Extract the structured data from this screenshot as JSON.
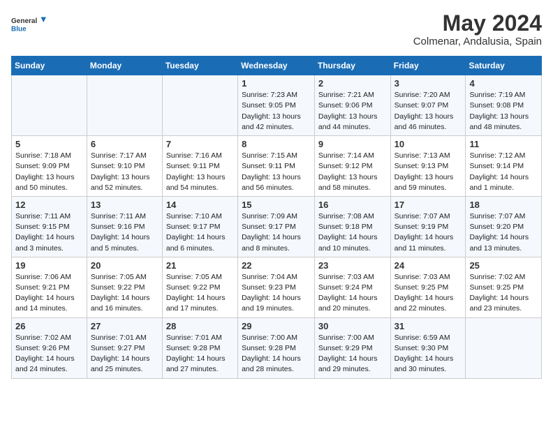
{
  "logo": {
    "text_general": "General",
    "text_blue": "Blue"
  },
  "header": {
    "month": "May 2024",
    "location": "Colmenar, Andalusia, Spain"
  },
  "weekdays": [
    "Sunday",
    "Monday",
    "Tuesday",
    "Wednesday",
    "Thursday",
    "Friday",
    "Saturday"
  ],
  "weeks": [
    [
      {
        "day": "",
        "info": ""
      },
      {
        "day": "",
        "info": ""
      },
      {
        "day": "",
        "info": ""
      },
      {
        "day": "1",
        "info": "Sunrise: 7:23 AM\nSunset: 9:05 PM\nDaylight: 13 hours\nand 42 minutes."
      },
      {
        "day": "2",
        "info": "Sunrise: 7:21 AM\nSunset: 9:06 PM\nDaylight: 13 hours\nand 44 minutes."
      },
      {
        "day": "3",
        "info": "Sunrise: 7:20 AM\nSunset: 9:07 PM\nDaylight: 13 hours\nand 46 minutes."
      },
      {
        "day": "4",
        "info": "Sunrise: 7:19 AM\nSunset: 9:08 PM\nDaylight: 13 hours\nand 48 minutes."
      }
    ],
    [
      {
        "day": "5",
        "info": "Sunrise: 7:18 AM\nSunset: 9:09 PM\nDaylight: 13 hours\nand 50 minutes."
      },
      {
        "day": "6",
        "info": "Sunrise: 7:17 AM\nSunset: 9:10 PM\nDaylight: 13 hours\nand 52 minutes."
      },
      {
        "day": "7",
        "info": "Sunrise: 7:16 AM\nSunset: 9:11 PM\nDaylight: 13 hours\nand 54 minutes."
      },
      {
        "day": "8",
        "info": "Sunrise: 7:15 AM\nSunset: 9:11 PM\nDaylight: 13 hours\nand 56 minutes."
      },
      {
        "day": "9",
        "info": "Sunrise: 7:14 AM\nSunset: 9:12 PM\nDaylight: 13 hours\nand 58 minutes."
      },
      {
        "day": "10",
        "info": "Sunrise: 7:13 AM\nSunset: 9:13 PM\nDaylight: 13 hours\nand 59 minutes."
      },
      {
        "day": "11",
        "info": "Sunrise: 7:12 AM\nSunset: 9:14 PM\nDaylight: 14 hours\nand 1 minute."
      }
    ],
    [
      {
        "day": "12",
        "info": "Sunrise: 7:11 AM\nSunset: 9:15 PM\nDaylight: 14 hours\nand 3 minutes."
      },
      {
        "day": "13",
        "info": "Sunrise: 7:11 AM\nSunset: 9:16 PM\nDaylight: 14 hours\nand 5 minutes."
      },
      {
        "day": "14",
        "info": "Sunrise: 7:10 AM\nSunset: 9:17 PM\nDaylight: 14 hours\nand 6 minutes."
      },
      {
        "day": "15",
        "info": "Sunrise: 7:09 AM\nSunset: 9:17 PM\nDaylight: 14 hours\nand 8 minutes."
      },
      {
        "day": "16",
        "info": "Sunrise: 7:08 AM\nSunset: 9:18 PM\nDaylight: 14 hours\nand 10 minutes."
      },
      {
        "day": "17",
        "info": "Sunrise: 7:07 AM\nSunset: 9:19 PM\nDaylight: 14 hours\nand 11 minutes."
      },
      {
        "day": "18",
        "info": "Sunrise: 7:07 AM\nSunset: 9:20 PM\nDaylight: 14 hours\nand 13 minutes."
      }
    ],
    [
      {
        "day": "19",
        "info": "Sunrise: 7:06 AM\nSunset: 9:21 PM\nDaylight: 14 hours\nand 14 minutes."
      },
      {
        "day": "20",
        "info": "Sunrise: 7:05 AM\nSunset: 9:22 PM\nDaylight: 14 hours\nand 16 minutes."
      },
      {
        "day": "21",
        "info": "Sunrise: 7:05 AM\nSunset: 9:22 PM\nDaylight: 14 hours\nand 17 minutes."
      },
      {
        "day": "22",
        "info": "Sunrise: 7:04 AM\nSunset: 9:23 PM\nDaylight: 14 hours\nand 19 minutes."
      },
      {
        "day": "23",
        "info": "Sunrise: 7:03 AM\nSunset: 9:24 PM\nDaylight: 14 hours\nand 20 minutes."
      },
      {
        "day": "24",
        "info": "Sunrise: 7:03 AM\nSunset: 9:25 PM\nDaylight: 14 hours\nand 22 minutes."
      },
      {
        "day": "25",
        "info": "Sunrise: 7:02 AM\nSunset: 9:25 PM\nDaylight: 14 hours\nand 23 minutes."
      }
    ],
    [
      {
        "day": "26",
        "info": "Sunrise: 7:02 AM\nSunset: 9:26 PM\nDaylight: 14 hours\nand 24 minutes."
      },
      {
        "day": "27",
        "info": "Sunrise: 7:01 AM\nSunset: 9:27 PM\nDaylight: 14 hours\nand 25 minutes."
      },
      {
        "day": "28",
        "info": "Sunrise: 7:01 AM\nSunset: 9:28 PM\nDaylight: 14 hours\nand 27 minutes."
      },
      {
        "day": "29",
        "info": "Sunrise: 7:00 AM\nSunset: 9:28 PM\nDaylight: 14 hours\nand 28 minutes."
      },
      {
        "day": "30",
        "info": "Sunrise: 7:00 AM\nSunset: 9:29 PM\nDaylight: 14 hours\nand 29 minutes."
      },
      {
        "day": "31",
        "info": "Sunrise: 6:59 AM\nSunset: 9:30 PM\nDaylight: 14 hours\nand 30 minutes."
      },
      {
        "day": "",
        "info": ""
      }
    ]
  ]
}
